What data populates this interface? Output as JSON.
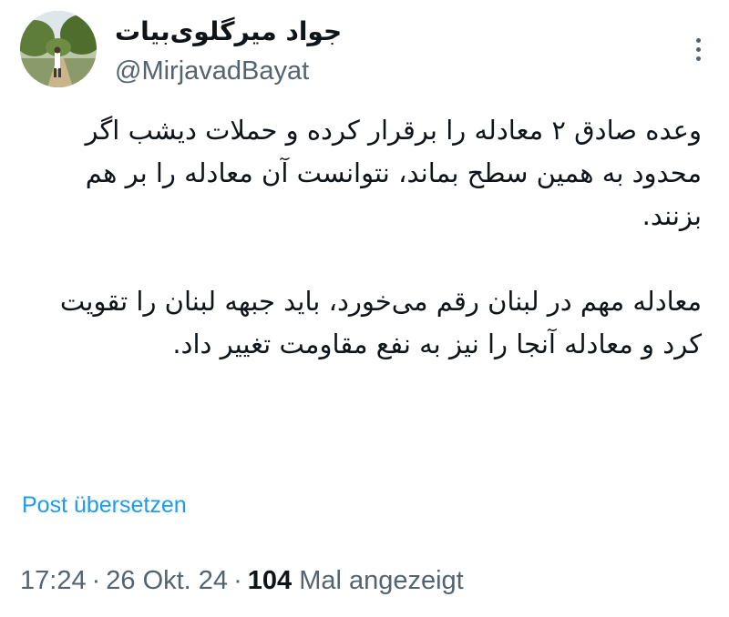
{
  "author": {
    "display_name": "جواد میرگلوی‌بیات",
    "handle": "@MirjavadBayat"
  },
  "tweet": {
    "paragraphs": [
      "وعده صادق ۲ معادله را برقرار کرده و حملات دیشب اگر محدود به همین سطح بماند، نتوانست آن معادله را بر هم بزنند.",
      "معادله مهم در لبنان رقم می‌خورد، باید جبهه لبنان را تقویت کرد و معادله آنجا را نیز به نفع مقاومت تغییر داد."
    ],
    "translate_label": "Post übersetzen"
  },
  "meta": {
    "time": "17:24",
    "separator": "·",
    "date": "26 Okt. 24",
    "views_count": "104",
    "views_label": "Mal angezeigt"
  },
  "colors": {
    "link": "#1d9bf0",
    "secondary_text": "#536471",
    "primary_text": "#0f1419"
  },
  "icons": {
    "more": "three-dots-vertical-icon"
  }
}
